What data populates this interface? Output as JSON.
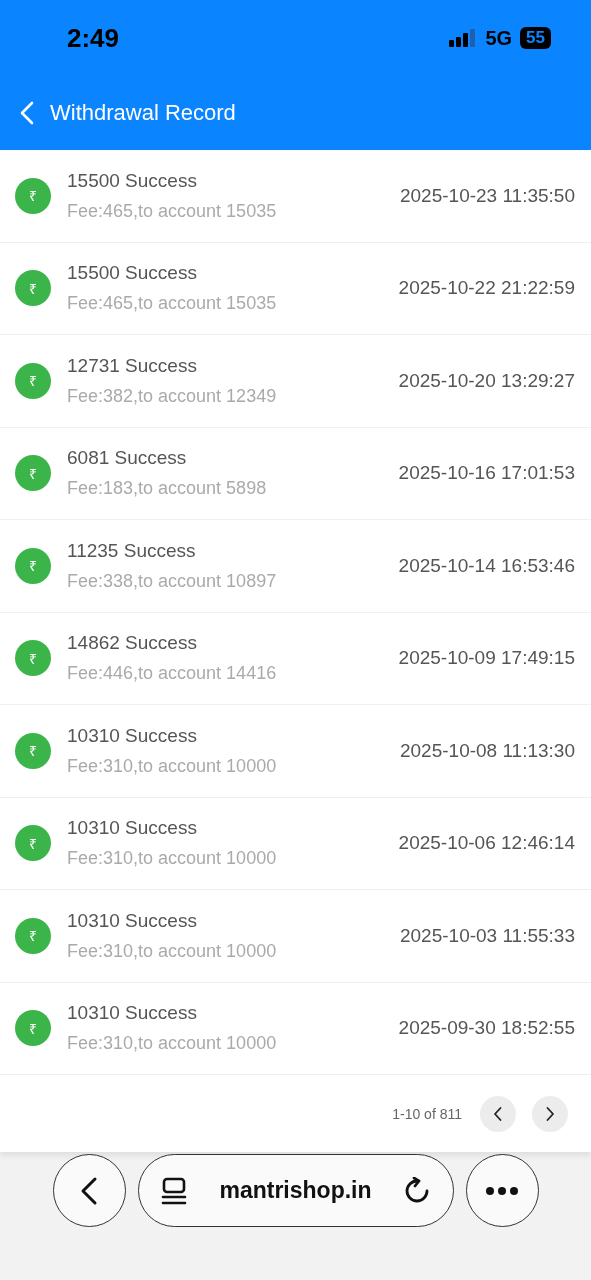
{
  "status_bar": {
    "time": "2:49",
    "network": "5G",
    "battery": "55"
  },
  "header": {
    "title": "Withdrawal Record"
  },
  "records": [
    {
      "icon": "₹",
      "title": "15500 Success",
      "detail": "Fee:465,to account 15035",
      "time": "2025-10-23 11:35:50"
    },
    {
      "icon": "₹",
      "title": "15500 Success",
      "detail": "Fee:465,to account 15035",
      "time": "2025-10-22 21:22:59"
    },
    {
      "icon": "₹",
      "title": "12731 Success",
      "detail": "Fee:382,to account 12349",
      "time": "2025-10-20 13:29:27"
    },
    {
      "icon": "₹",
      "title": "6081 Success",
      "detail": "Fee:183,to account 5898",
      "time": "2025-10-16 17:01:53"
    },
    {
      "icon": "₹",
      "title": "11235 Success",
      "detail": "Fee:338,to account 10897",
      "time": "2025-10-14 16:53:46"
    },
    {
      "icon": "₹",
      "title": "14862 Success",
      "detail": "Fee:446,to account 14416",
      "time": "2025-10-09 17:49:15"
    },
    {
      "icon": "₹",
      "title": "10310 Success",
      "detail": "Fee:310,to account 10000",
      "time": "2025-10-08 11:13:30"
    },
    {
      "icon": "₹",
      "title": "10310 Success",
      "detail": "Fee:310,to account 10000",
      "time": "2025-10-06 12:46:14"
    },
    {
      "icon": "₹",
      "title": "10310 Success",
      "detail": "Fee:310,to account 10000",
      "time": "2025-10-03 11:55:33"
    },
    {
      "icon": "₹",
      "title": "10310 Success",
      "detail": "Fee:310,to account 10000",
      "time": "2025-09-30 18:52:55"
    }
  ],
  "pagination": {
    "range": "1-10 of 811"
  },
  "browser_bar": {
    "url": "mantrishop.in"
  }
}
